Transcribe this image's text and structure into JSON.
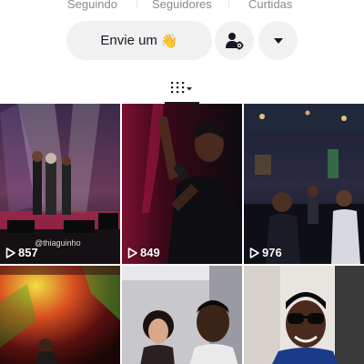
{
  "profile_stats": {
    "following_label": "Seguindo",
    "followers_label": "Seguidores",
    "likes_label": "Curtidas"
  },
  "actions": {
    "message_label": "Envie um",
    "message_emoji": "👋",
    "add_friend_icon": "person-settings-icon",
    "more_icon": "caret-down-icon"
  },
  "tabs": {
    "active_icon": "grid-filter-icon"
  },
  "videos": [
    {
      "views": "857",
      "watermark": "@thiaguinho"
    },
    {
      "views": "849"
    },
    {
      "views": "976"
    },
    {},
    {},
    {}
  ],
  "colors": {
    "button_bg": "#f1f1f2",
    "label_gray": "#8a8b91",
    "text": "#161823"
  }
}
